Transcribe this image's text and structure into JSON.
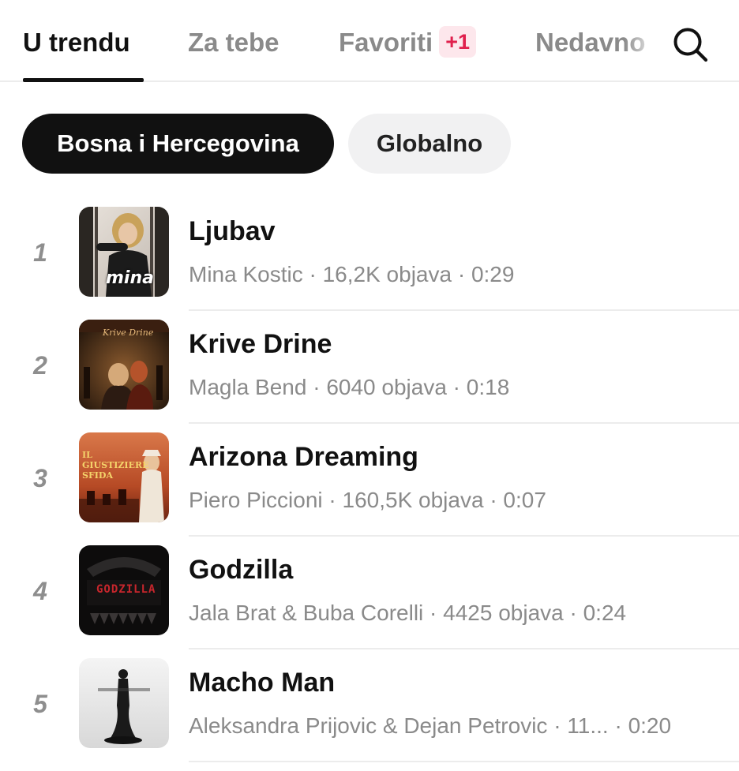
{
  "tabs": [
    {
      "label": "U trendu",
      "active": true
    },
    {
      "label": "Za tebe",
      "active": false
    },
    {
      "label": "Favoriti",
      "active": false,
      "badge": "+1"
    },
    {
      "label": "Nedavno",
      "active": false
    }
  ],
  "search": {
    "icon": "search-icon"
  },
  "regions": [
    {
      "label": "Bosna i Hercegovina",
      "selected": true
    },
    {
      "label": "Globalno",
      "selected": false
    }
  ],
  "tracks": [
    {
      "rank": "1",
      "title": "Ljubav",
      "meta": "Mina Kostic · 16,2K objava · 0:29",
      "cover_text": "mina"
    },
    {
      "rank": "2",
      "title": "Krive Drine",
      "meta": "Magla Bend · 6040 objava · 0:18",
      "cover_text": "Krive Drine"
    },
    {
      "rank": "3",
      "title": "Arizona Dreaming",
      "meta": "Piero Piccioni · 160,5K objava · 0:07",
      "cover_text": "IL GIUSTIZIERE SFIDA"
    },
    {
      "rank": "4",
      "title": "Godzilla",
      "meta": "Jala Brat & Buba Corelli · 4425 objava · 0:24",
      "cover_text": "GODZILLA"
    },
    {
      "rank": "5",
      "title": "Macho Man",
      "meta": "Aleksandra Prijovic & Dejan Petrovic · 11...  · 0:20"
    }
  ],
  "colors": {
    "accent": "#111111",
    "badge_bg": "#fde7ec",
    "badge_text": "#e0204d",
    "muted": "#8a8a8a"
  }
}
